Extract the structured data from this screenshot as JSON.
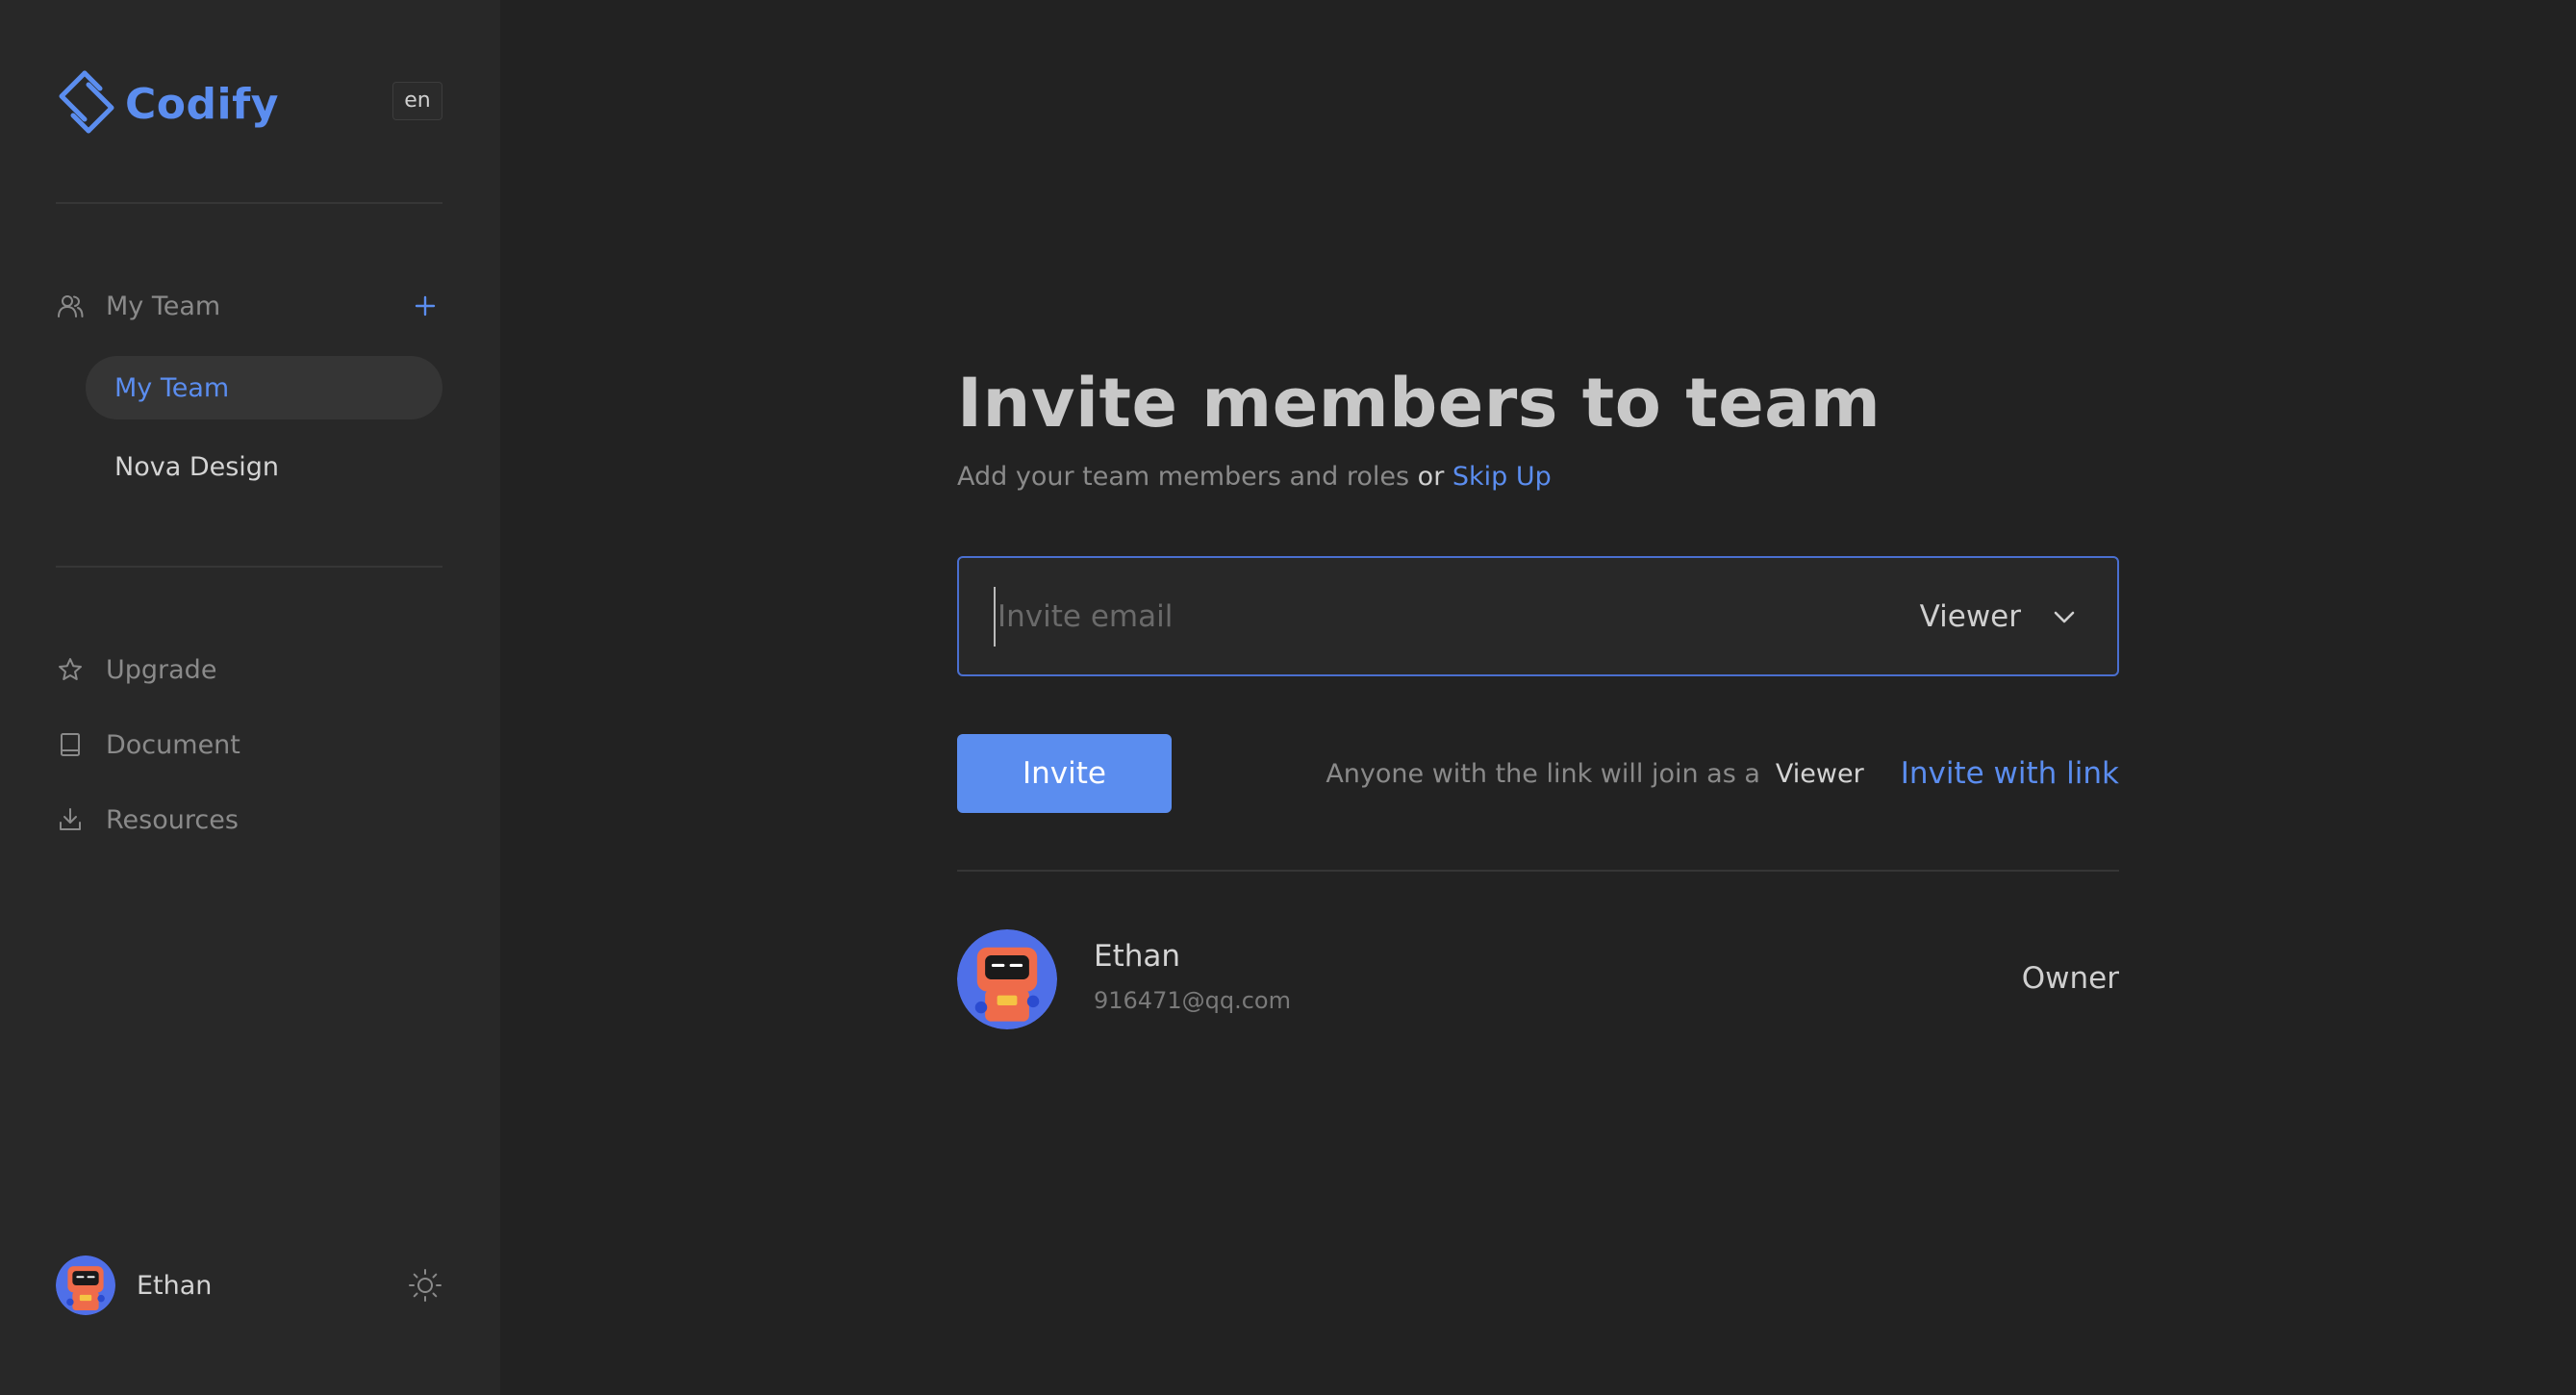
{
  "app": {
    "name": "Codify",
    "language": "en",
    "accent_color": "#5b8def"
  },
  "sidebar": {
    "team_section": {
      "label": "My Team",
      "icon": "users-icon",
      "add_icon": "plus-icon"
    },
    "teams": [
      {
        "label": "My Team",
        "active": true
      },
      {
        "label": "Nova Design",
        "active": false
      }
    ],
    "menu": [
      {
        "label": "Upgrade",
        "icon": "star-icon"
      },
      {
        "label": "Document",
        "icon": "book-icon"
      },
      {
        "label": "Resources",
        "icon": "download-icon"
      }
    ],
    "user": {
      "name": "Ethan",
      "theme_icon": "sun-icon"
    }
  },
  "main": {
    "title": "Invite members to team",
    "subtitle": {
      "text": "Add your team members and roles",
      "or": "or",
      "skip_link": "Skip Up"
    },
    "invite": {
      "email_placeholder": "Invite email",
      "email_value": "",
      "role": "Viewer",
      "button": "Invite"
    },
    "link_invite": {
      "hint": "Anyone with the link will join as a",
      "role": "Viewer",
      "link_label": "Invite with link"
    },
    "members": [
      {
        "name": "Ethan",
        "email": "916471@qq.com",
        "role": "Owner"
      }
    ]
  }
}
